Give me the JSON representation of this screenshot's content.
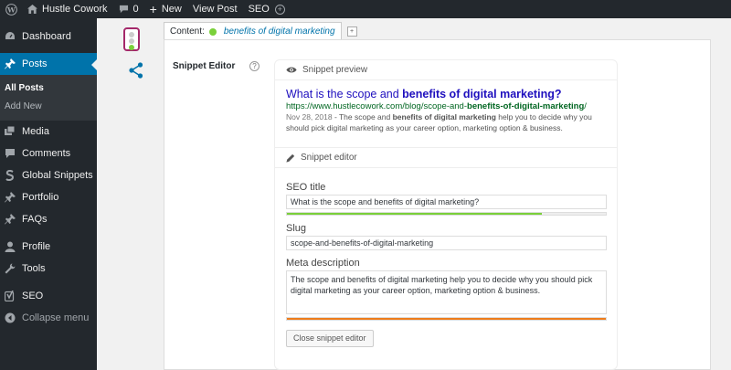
{
  "adminbar": {
    "site_name": "Hustle Cowork",
    "comments_count": "0",
    "new_label": "New",
    "view_post_label": "View Post",
    "seo_label": "SEO"
  },
  "sidebar": {
    "items": [
      {
        "label": "Dashboard",
        "icon": "dashboard-icon"
      },
      {
        "label": "Posts",
        "icon": "pin-icon",
        "current": true
      },
      {
        "label": "Media",
        "icon": "media-icon"
      },
      {
        "label": "Comments",
        "icon": "comment-icon"
      },
      {
        "label": "Global Snippets",
        "icon": "snippet-icon"
      },
      {
        "label": "Portfolio",
        "icon": "pin-icon"
      },
      {
        "label": "FAQs",
        "icon": "pin-icon"
      },
      {
        "label": "Profile",
        "icon": "user-icon"
      },
      {
        "label": "Tools",
        "icon": "wrench-icon"
      },
      {
        "label": "SEO",
        "icon": "yoast-icon"
      },
      {
        "label": "Collapse menu",
        "icon": "collapse-icon"
      }
    ],
    "submenu": [
      "All Posts",
      "Add New"
    ]
  },
  "yoast": {
    "content_tab_label": "Content:",
    "focus_keyword": "benefits of digital marketing",
    "snippet_editor_label": "Snippet Editor",
    "help_label": "?",
    "preview_heading": "Snippet preview",
    "editor_heading": "Snippet editor",
    "preview": {
      "title_plain": "What is the scope and ",
      "title_bold": "benefits of digital marketing?",
      "url_plain": "https://www.hustlecowork.com/blog/scope-and-",
      "url_bold": "benefits-of-digital-marketing",
      "url_tail": "/",
      "date": "Nov 28, 2018",
      "desc_pre": " - The scope and ",
      "desc_bold": "benefits of digital marketing",
      "desc_post": " help you to decide why you should pick digital marketing as your career option, marketing option & business."
    },
    "seo_title_label": "SEO title",
    "seo_title_value": "What is the scope and benefits of digital marketing?",
    "seo_title_progress": 0.8,
    "slug_label": "Slug",
    "slug_value": "scope-and-benefits-of-digital-marketing",
    "meta_label": "Meta description",
    "meta_value": "The scope and benefits of digital marketing help you to decide why you should pick digital marketing as your career option, marketing option & business.",
    "meta_progress": 1.0,
    "close_button": "Close snippet editor"
  },
  "colors": {
    "progress_green": "#7ad03a",
    "progress_orange": "#ee7c1b",
    "accent_blue": "#0073aa",
    "yoast_purple": "#a4286a"
  }
}
